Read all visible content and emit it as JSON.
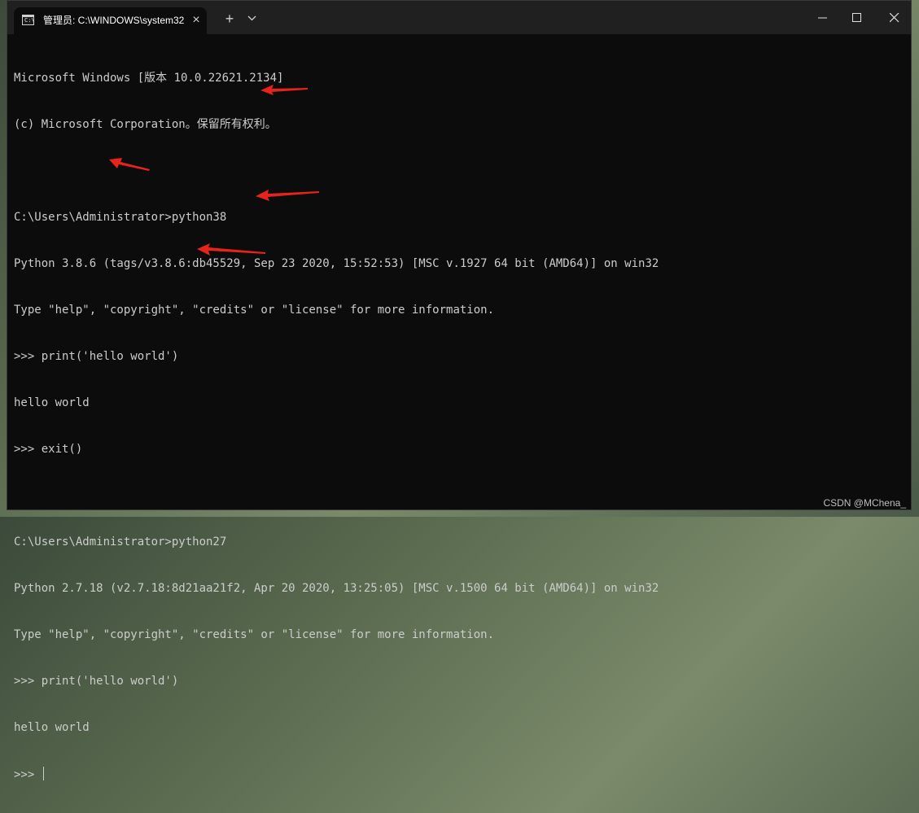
{
  "window": {
    "tab_title": "管理员: C:\\WINDOWS\\system32",
    "tab_close": "×",
    "new_tab": "+",
    "icon_glyph": "C:\\"
  },
  "console": {
    "lines": [
      "Microsoft Windows [版本 10.0.22621.2134]",
      "(c) Microsoft Corporation。保留所有权利。",
      "",
      "C:\\Users\\Administrator>python38",
      "Python 3.8.6 (tags/v3.8.6:db45529, Sep 23 2020, 15:52:53) [MSC v.1927 64 bit (AMD64)] on win32",
      "Type \"help\", \"copyright\", \"credits\" or \"license\" for more information.",
      ">>> print('hello world')",
      "hello world",
      ">>> exit()",
      "",
      "C:\\Users\\Administrator>python27",
      "Python 2.7.18 (v2.7.18:8d21aa21f2, Apr 20 2020, 13:25:05) [MSC v.1500 64 bit (AMD64)] on win32",
      "Type \"help\", \"copyright\", \"credits\" or \"license\" for more information.",
      ">>> print('hello world')",
      "hello world"
    ],
    "prompt": ">>> "
  },
  "annotations": {
    "arrow_color": "#e8231c"
  },
  "watermark": "CSDN @MChena_"
}
